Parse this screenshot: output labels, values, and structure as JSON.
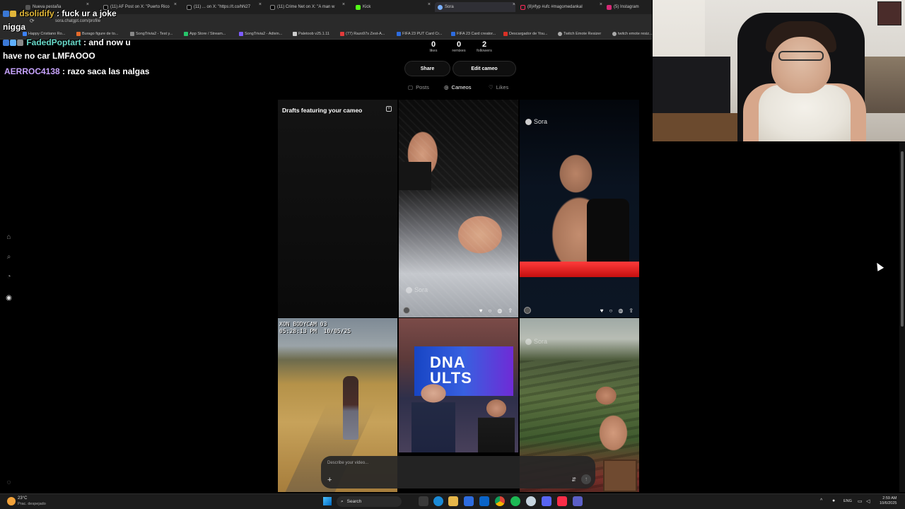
{
  "browser": {
    "tabs": [
      {
        "label": "Nueva pestaña",
        "active": false
      },
      {
        "label": "(11) AF Post on X: \"Puerto Rico",
        "active": false
      },
      {
        "label": "(11) ... on X: \"https://t.co/hN27",
        "active": false
      },
      {
        "label": "(11) Crime Net on X: \"A man w",
        "active": false
      },
      {
        "label": "Kick",
        "active": false
      },
      {
        "label": "Sora",
        "active": true
      },
      {
        "label": "(8)#fyp #ufc #magomedankal",
        "active": false
      },
      {
        "label": "(5) Instagram",
        "active": false
      }
    ],
    "url": "sora.chatgpt.com/profile",
    "bookmarks": [
      "Happy Cristiano Ro...",
      "Burago figure de to...",
      "SongTrivia2 - Test y...",
      "App Store / Stream...",
      "SongTrivia2 - Adivin...",
      "Paletoob v25.1.11",
      "(77) Razo97s Zest-A...",
      "FIFA 23 PUT Card Cr...",
      "FIFA 23 Card creator...",
      "Descargador de You...",
      "Twitch Emote Resizer",
      "twitch emote resiz..."
    ]
  },
  "chat": [
    {
      "user": "dsolidify",
      "message": ": fuck ur a joke",
      "continuation": "nigga",
      "color": "#e3b93a"
    },
    {
      "user": "FadedPoptart",
      "message": ": and now u",
      "continuation": "have no car LMFAOOO",
      "color": "#67d8c8"
    },
    {
      "user": "AERROC4138",
      "message": ": razo saca las nalgas",
      "continuation": "",
      "color": "#c8a4ff"
    }
  ],
  "profile": {
    "stats": [
      {
        "value": "0",
        "label": "likes"
      },
      {
        "value": "0",
        "label": "remixes"
      },
      {
        "value": "2",
        "label": "followers"
      }
    ],
    "share_label": "Share",
    "edit_label": "Edit cameo",
    "tabs": [
      {
        "label": "Posts",
        "icon": "posts-icon",
        "active": false
      },
      {
        "label": "Cameos",
        "icon": "cameo-icon",
        "active": true
      },
      {
        "label": "Likes",
        "icon": "heart-icon",
        "active": false
      }
    ],
    "drafts_title": "Drafts featuring your cameo",
    "watermark": "Sora",
    "camera_overlay": "XON BODYCAM 03\n05:28:13 PM  10/05/25",
    "news_screen_text": "DNA\nULTS"
  },
  "prompt": {
    "placeholder": "Describe your video..."
  },
  "taskbar": {
    "weather_temp": "23°C",
    "weather_desc": "Prac. despejado",
    "search_label": "Search",
    "lang": "ENG",
    "time": "2:59 AM",
    "date": "10/6/2025"
  }
}
